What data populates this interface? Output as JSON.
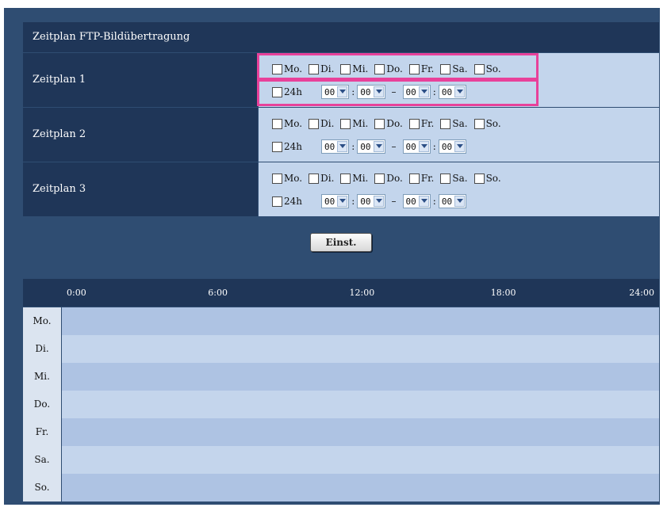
{
  "title": "Zeitplan FTP-Bildübertragung",
  "schedules": [
    {
      "label": "Zeitplan 1"
    },
    {
      "label": "Zeitplan 2"
    },
    {
      "label": "Zeitplan 3"
    }
  ],
  "days": [
    "Mo.",
    "Di.",
    "Mi.",
    "Do.",
    "Fr.",
    "Sa.",
    "So."
  ],
  "time": {
    "label_24h": "24h",
    "start_hour": "00",
    "start_minute": "00",
    "end_hour": "00",
    "end_minute": "00",
    "colon": ":",
    "dash": "–"
  },
  "button_label": "Einst.",
  "timeline": {
    "hours": [
      "0:00",
      "6:00",
      "12:00",
      "18:00",
      "24:00"
    ],
    "rows": [
      "Mo.",
      "Di.",
      "Mi.",
      "Do.",
      "Fr.",
      "Sa.",
      "So."
    ]
  },
  "colors": {
    "panel": "#2f4d72",
    "header": "#1f3658",
    "control_bg": "#c3d5ec",
    "row_even": "#aec3e3",
    "row_odd": "#c4d5ec",
    "highlight": "#e8419a"
  }
}
